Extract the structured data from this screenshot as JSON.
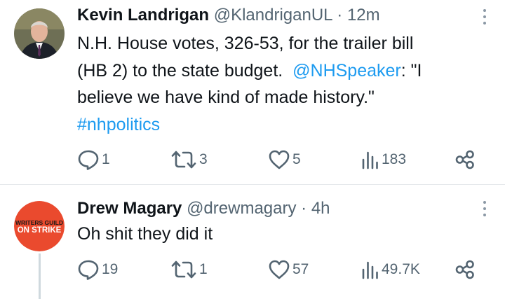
{
  "tweets": [
    {
      "author": {
        "name": "Kevin Landrigan",
        "handle": "@KlandriganUL",
        "separator": "·",
        "time": "12m"
      },
      "text_parts": {
        "line1": "N.H. House votes, 326-53, for the trailer bill",
        "line2_pre": "(HB 2) to the state budget.",
        "mention": "@NHSpeaker",
        "line2_post": ": \"I",
        "line3": "believe we have kind of made history.\"",
        "hashtag": "#nhpolitics"
      },
      "actions": {
        "replies": "1",
        "retweets": "3",
        "likes": "5",
        "views": "183"
      }
    },
    {
      "author": {
        "name": "Drew Magary",
        "handle": "@drewmagary",
        "separator": "·",
        "time": "4h",
        "avatar_text_top": "WRITERS GUILD",
        "avatar_text_bottom": "ON STRIKE"
      },
      "text": "Oh shit they did it",
      "actions": {
        "replies": "19",
        "retweets": "1",
        "likes": "57",
        "views": "49.7K"
      }
    }
  ],
  "icons": {
    "reply": "reply-icon",
    "retweet": "retweet-icon",
    "like": "heart-icon",
    "views": "views-icon",
    "share": "share-icon",
    "more": "more-icon"
  },
  "colors": {
    "link": "#1d9bf0",
    "muted": "#536471",
    "strike_badge": "#ea4a2e"
  }
}
